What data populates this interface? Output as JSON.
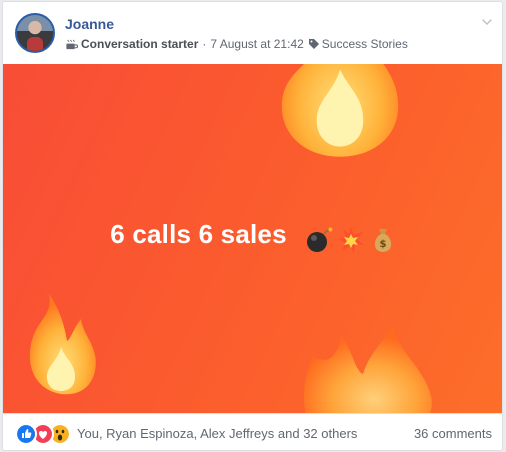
{
  "post": {
    "author": "Joanne",
    "badge_icon": "coffee-cup-icon",
    "badge_label": "Conversation starter",
    "separator": "·",
    "timestamp": "7 August at 21:42",
    "tag_icon": "tag-icon",
    "group_topic": "Success Stories"
  },
  "banner": {
    "text": "6 calls 6 sales",
    "emojis": [
      "bomb-icon",
      "collision-icon",
      "money-bag-icon"
    ],
    "background": "#fb5a2e",
    "decorations": [
      "fire-icon",
      "fire-icon",
      "fire-icon"
    ]
  },
  "footer": {
    "reactions": [
      "like-icon",
      "love-icon",
      "wow-icon"
    ],
    "reaction_names": "You, Ryan Espinoza, Alex Jeffreys and 32 others",
    "comments": "36 comments"
  },
  "colors": {
    "author_link": "#385898",
    "meta_text": "#606770",
    "like_blue": "#1877f2",
    "love_red": "#f33e58",
    "wow_yellow": "#f7b125"
  }
}
